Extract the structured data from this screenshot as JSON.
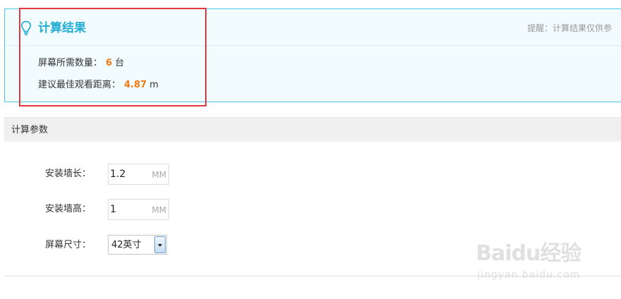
{
  "result": {
    "title": "计算结果",
    "hint": "提醒：计算结果仅供参",
    "screen_count_label": "屏幕所需数量：",
    "screen_count_value": "6",
    "screen_count_unit": "台",
    "distance_label": "建议最佳观看距离：",
    "distance_value": "4.87",
    "distance_unit": "m"
  },
  "params": {
    "title": "计算参数",
    "wall_length_label": "安装墙长：",
    "wall_length_value": "1.2",
    "wall_length_unit": "MM",
    "wall_height_label": "安装墙高：",
    "wall_height_value": "1",
    "wall_height_unit": "MM",
    "screen_size_label": "屏幕尺寸：",
    "screen_size_value": "42英寸"
  },
  "watermark": {
    "text": "Baidu经验",
    "subtext": "jingyan.baidu.com"
  },
  "icons": {
    "bulb": "lightbulb-icon",
    "select_arrow": "chevron-down-icon"
  },
  "colors": {
    "accent": "#25aed4",
    "panel_border": "#4fc6e6",
    "highlight_value": "#f07a11",
    "annotation_frame": "#e2383b"
  }
}
